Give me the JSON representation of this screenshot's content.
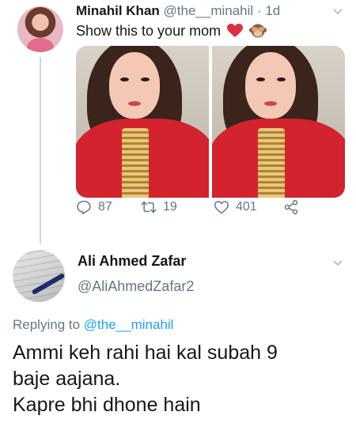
{
  "tweet": {
    "author_name": "Minahil Khan",
    "author_handle": "@the__minahil",
    "separator": " · ",
    "time": "1d",
    "text": "Show this to your mom",
    "emojis": [
      "red-heart-emoji",
      "see-no-evil-monkey-emoji"
    ],
    "media_count": 2,
    "stats": {
      "replies": "87",
      "retweets": "19",
      "likes": "401"
    }
  },
  "reply": {
    "author_name": "Ali Ahmed Zafar",
    "author_handle": "@AliAhmedZafar2",
    "replying_prefix": "Replying to",
    "replying_to": "@the__minahil",
    "text_lines": [
      "Ammi keh rahi hai kal subah 9",
      "baje aajana.",
      "Kapre bhi dhone hain"
    ]
  },
  "colors": {
    "text": "#14171a",
    "muted": "#657786",
    "link": "#1da1f2",
    "heart": "#e0245e"
  }
}
